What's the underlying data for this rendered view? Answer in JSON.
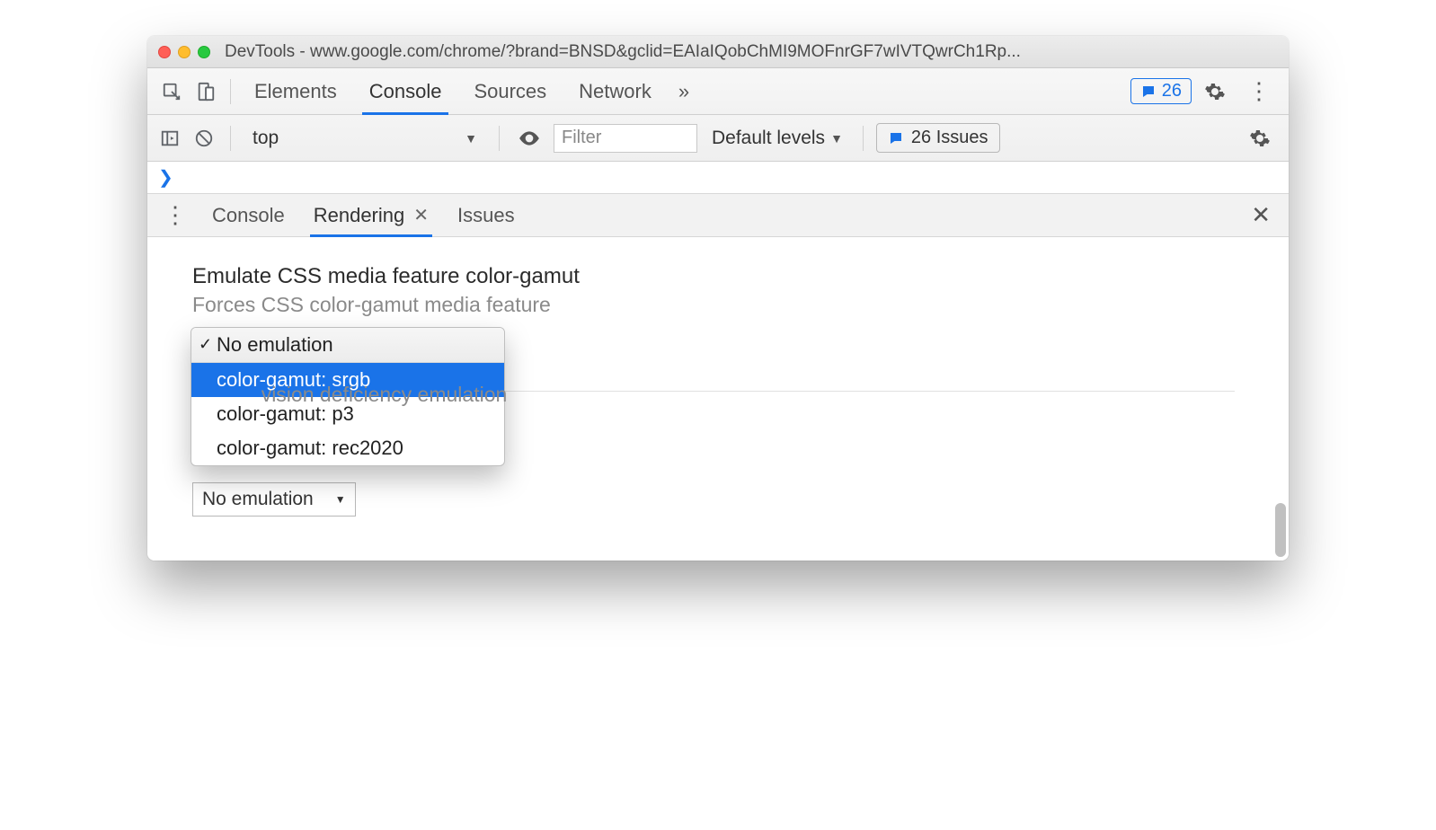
{
  "window": {
    "title": "DevTools - www.google.com/chrome/?brand=BNSD&gclid=EAIaIQobChMI9MOFnrGF7wIVTQwrCh1Rp..."
  },
  "tabs": {
    "items": [
      "Elements",
      "Console",
      "Sources",
      "Network"
    ],
    "active_index": 1,
    "issues_count": "26"
  },
  "console_toolbar": {
    "context": "top",
    "filter_placeholder": "Filter",
    "levels_label": "Default levels",
    "issues_label": "26 Issues"
  },
  "console_prompt": "❯",
  "drawer": {
    "tabs": [
      "Console",
      "Rendering",
      "Issues"
    ],
    "active_index": 1
  },
  "rendering": {
    "color_gamut": {
      "title": "Emulate CSS media feature color-gamut",
      "subtitle": "Forces CSS color-gamut media feature",
      "options": [
        "No emulation",
        "color-gamut: srgb",
        "color-gamut: p3",
        "color-gamut: rec2020"
      ],
      "selected_index": 0,
      "highlight_index": 1
    },
    "vision": {
      "subtitle_fragment": "vision deficiency emulation",
      "select_value": "No emulation"
    }
  }
}
